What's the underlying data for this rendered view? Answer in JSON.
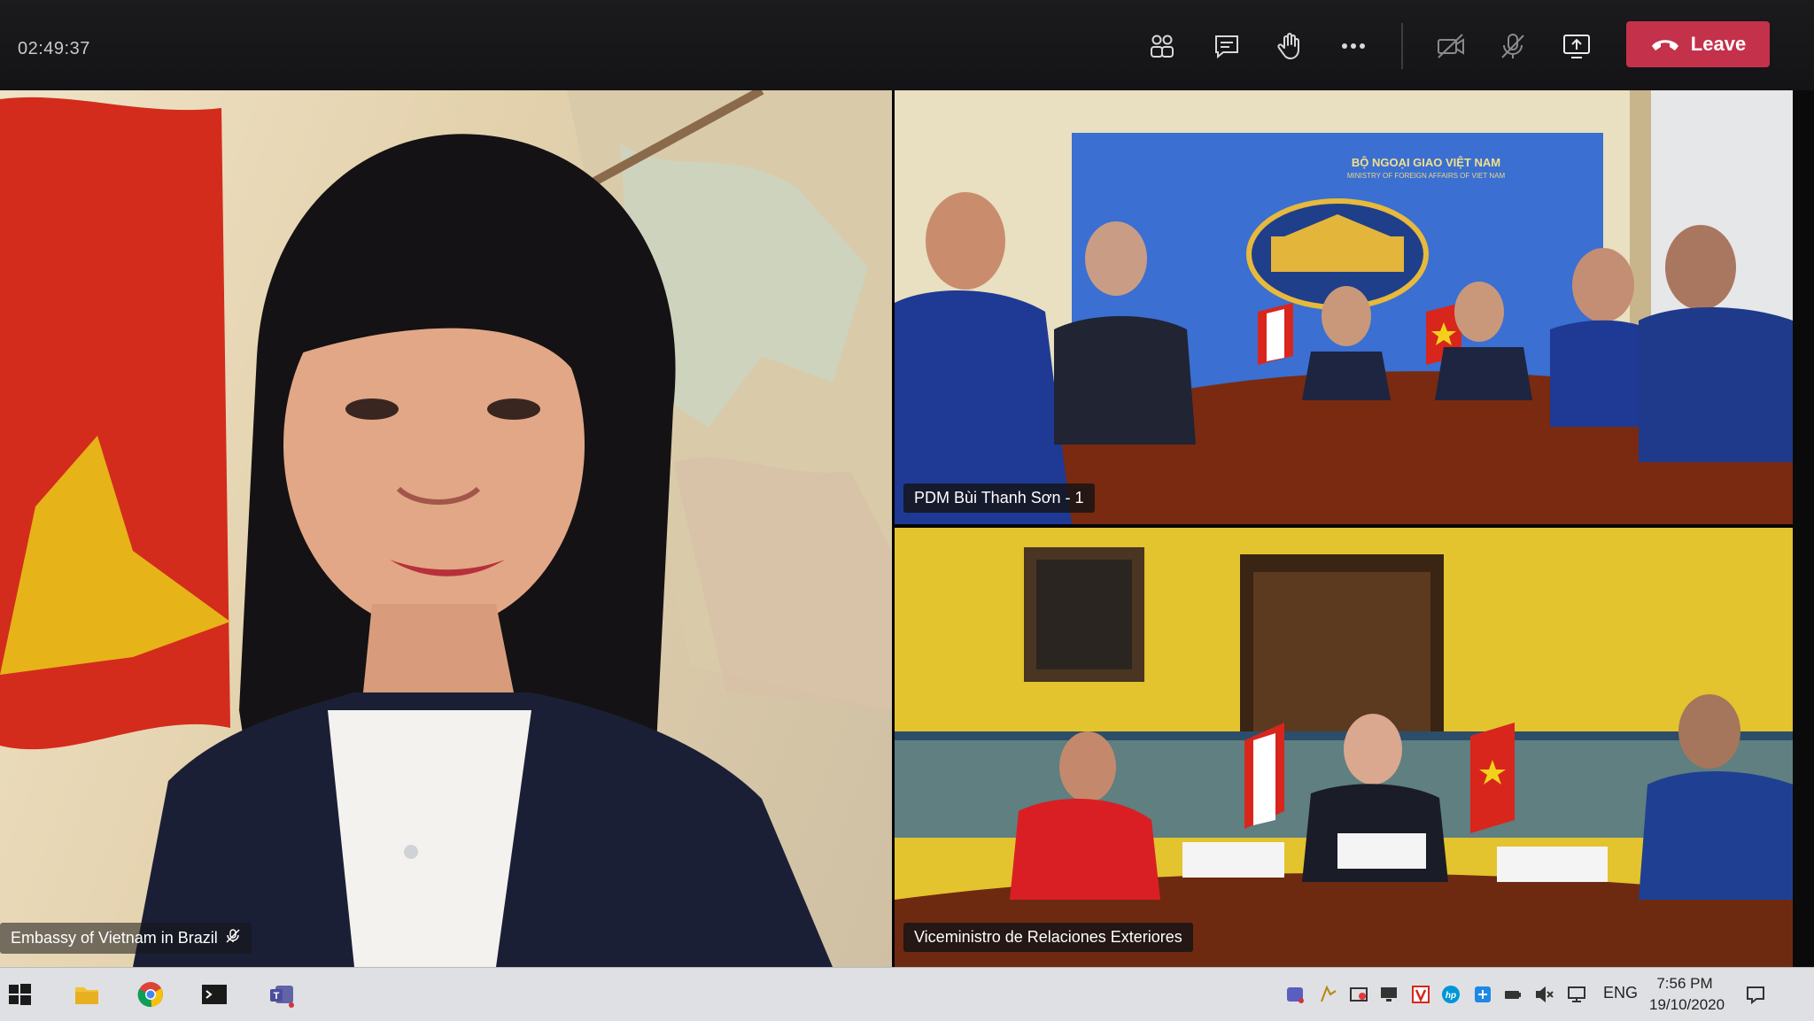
{
  "call": {
    "timer": "02:49:37",
    "leave_label": "Leave",
    "leave_color": "#c4314b"
  },
  "toolbar": {
    "icons": [
      "participants-icon",
      "chat-icon",
      "raise-hand-icon",
      "more-options-icon",
      "camera-off-icon",
      "mic-off-icon",
      "share-screen-icon"
    ]
  },
  "tiles": {
    "left": {
      "name": "Embassy of Vietnam in Brazil"
    },
    "top_right": {
      "name": "PDM Bùi Thanh Sơn - 1",
      "banner_line1": "BỘ NGOẠI GIAO VIỆT NAM",
      "banner_line2": "MINISTRY OF FOREIGN AFFAIRS OF VIET NAM"
    },
    "bottom_right": {
      "name": "Viceministro de Relaciones Exteriores"
    }
  },
  "taskbar": {
    "language": "ENG",
    "time": "7:56 PM",
    "date": "19/10/2020"
  }
}
